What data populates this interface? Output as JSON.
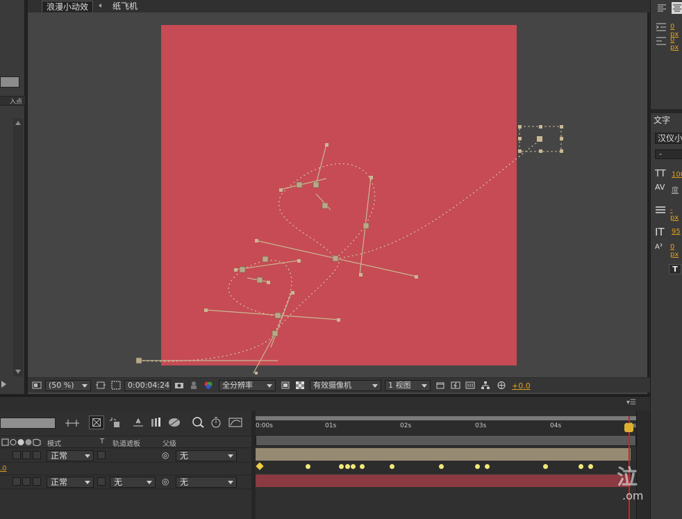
{
  "viewer": {
    "tab_active": "浪漫小动效",
    "tab_second": "纸飞机"
  },
  "left_panel": {
    "header_label": "入点"
  },
  "viewer_toolbar": {
    "zoom": "(50 %)",
    "timecode": "0:00:04:24",
    "resolution": "全分辨率",
    "camera": "有效摄像机",
    "views": "1 视图",
    "exposure": "+0.0"
  },
  "right_panel": {
    "align_values": [
      "0 px",
      "0 px"
    ],
    "text_panel_title": "文字",
    "font_family": "汉仪小",
    "font_style": "-",
    "font_size": "100",
    "tracking": "度",
    "leading_unit": "- px",
    "vertical_scale": "95",
    "baseline": "0 px",
    "bold_label": "T"
  },
  "timeline": {
    "columns": {
      "mode": "模式",
      "t": "T",
      "track_matte": "轨道遮板",
      "parent": "父级"
    },
    "layers": [
      {
        "mode": "正常",
        "parent": "无",
        "track_matte": ""
      },
      {
        "mode": "正常",
        "parent": "无",
        "track_matte": "无"
      }
    ],
    "row_value": ".0",
    "ruler_labels": [
      "0:00s",
      "01s",
      "02s",
      "03s",
      "04s",
      "05s"
    ],
    "keyframe_count": 13
  },
  "watermark": {
    "glyph": "泣",
    "text": ".om"
  },
  "colors": {
    "canvas": "#c64b54",
    "path": "#d6c7a7",
    "keyframe": "#f0e87a",
    "accent": "#e0a020",
    "playhead": "#d02020"
  }
}
